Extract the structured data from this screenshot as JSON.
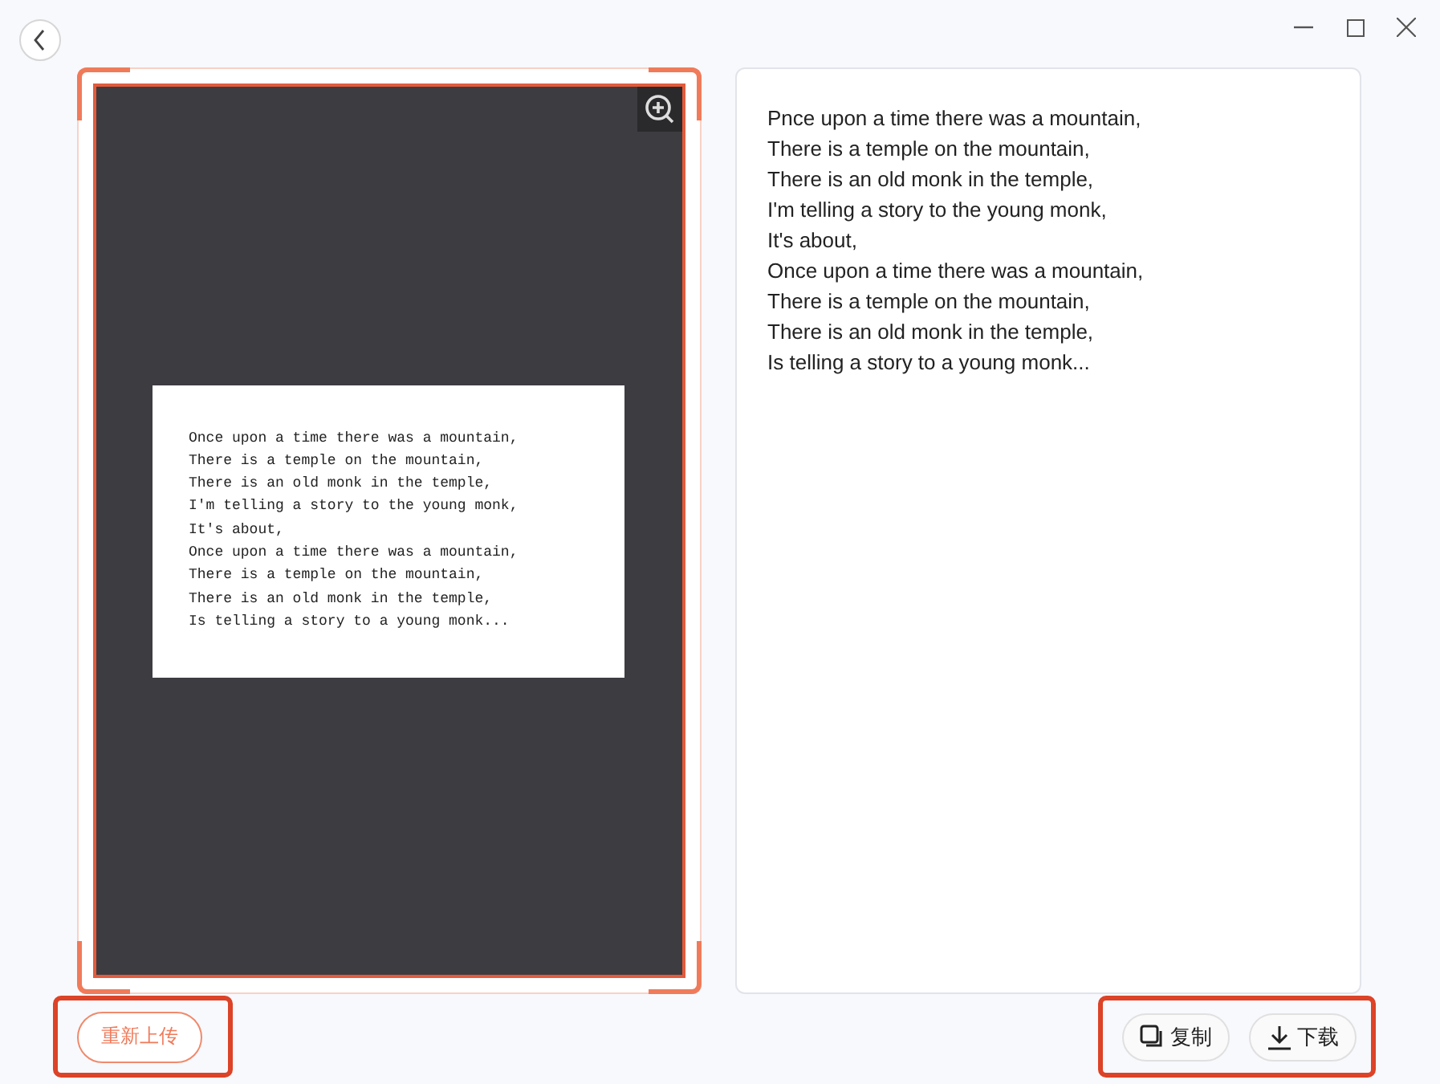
{
  "preview": {
    "lines": [
      "Once upon a time there was a mountain,",
      "There is a temple on the mountain,",
      "There is an old monk in the temple,",
      "I'm telling a story to the young monk,",
      "It's about,",
      "Once upon a time there was a mountain,",
      "There is a temple on the mountain,",
      "There is an old monk in the temple,",
      "Is telling a story to a young monk..."
    ]
  },
  "result": {
    "lines": [
      "Pnce upon a time there was a mountain,",
      "There is a temple on the mountain,",
      "There is an old monk in the temple,",
      "I'm telling a story to the young monk,",
      "It's about,",
      "Once upon a time there was a mountain,",
      "There is a temple on the mountain,",
      "There is an old monk in the temple,",
      "Is telling a story to a young monk..."
    ]
  },
  "buttons": {
    "reupload": "重新上传",
    "copy": "复制",
    "download": "下载"
  }
}
